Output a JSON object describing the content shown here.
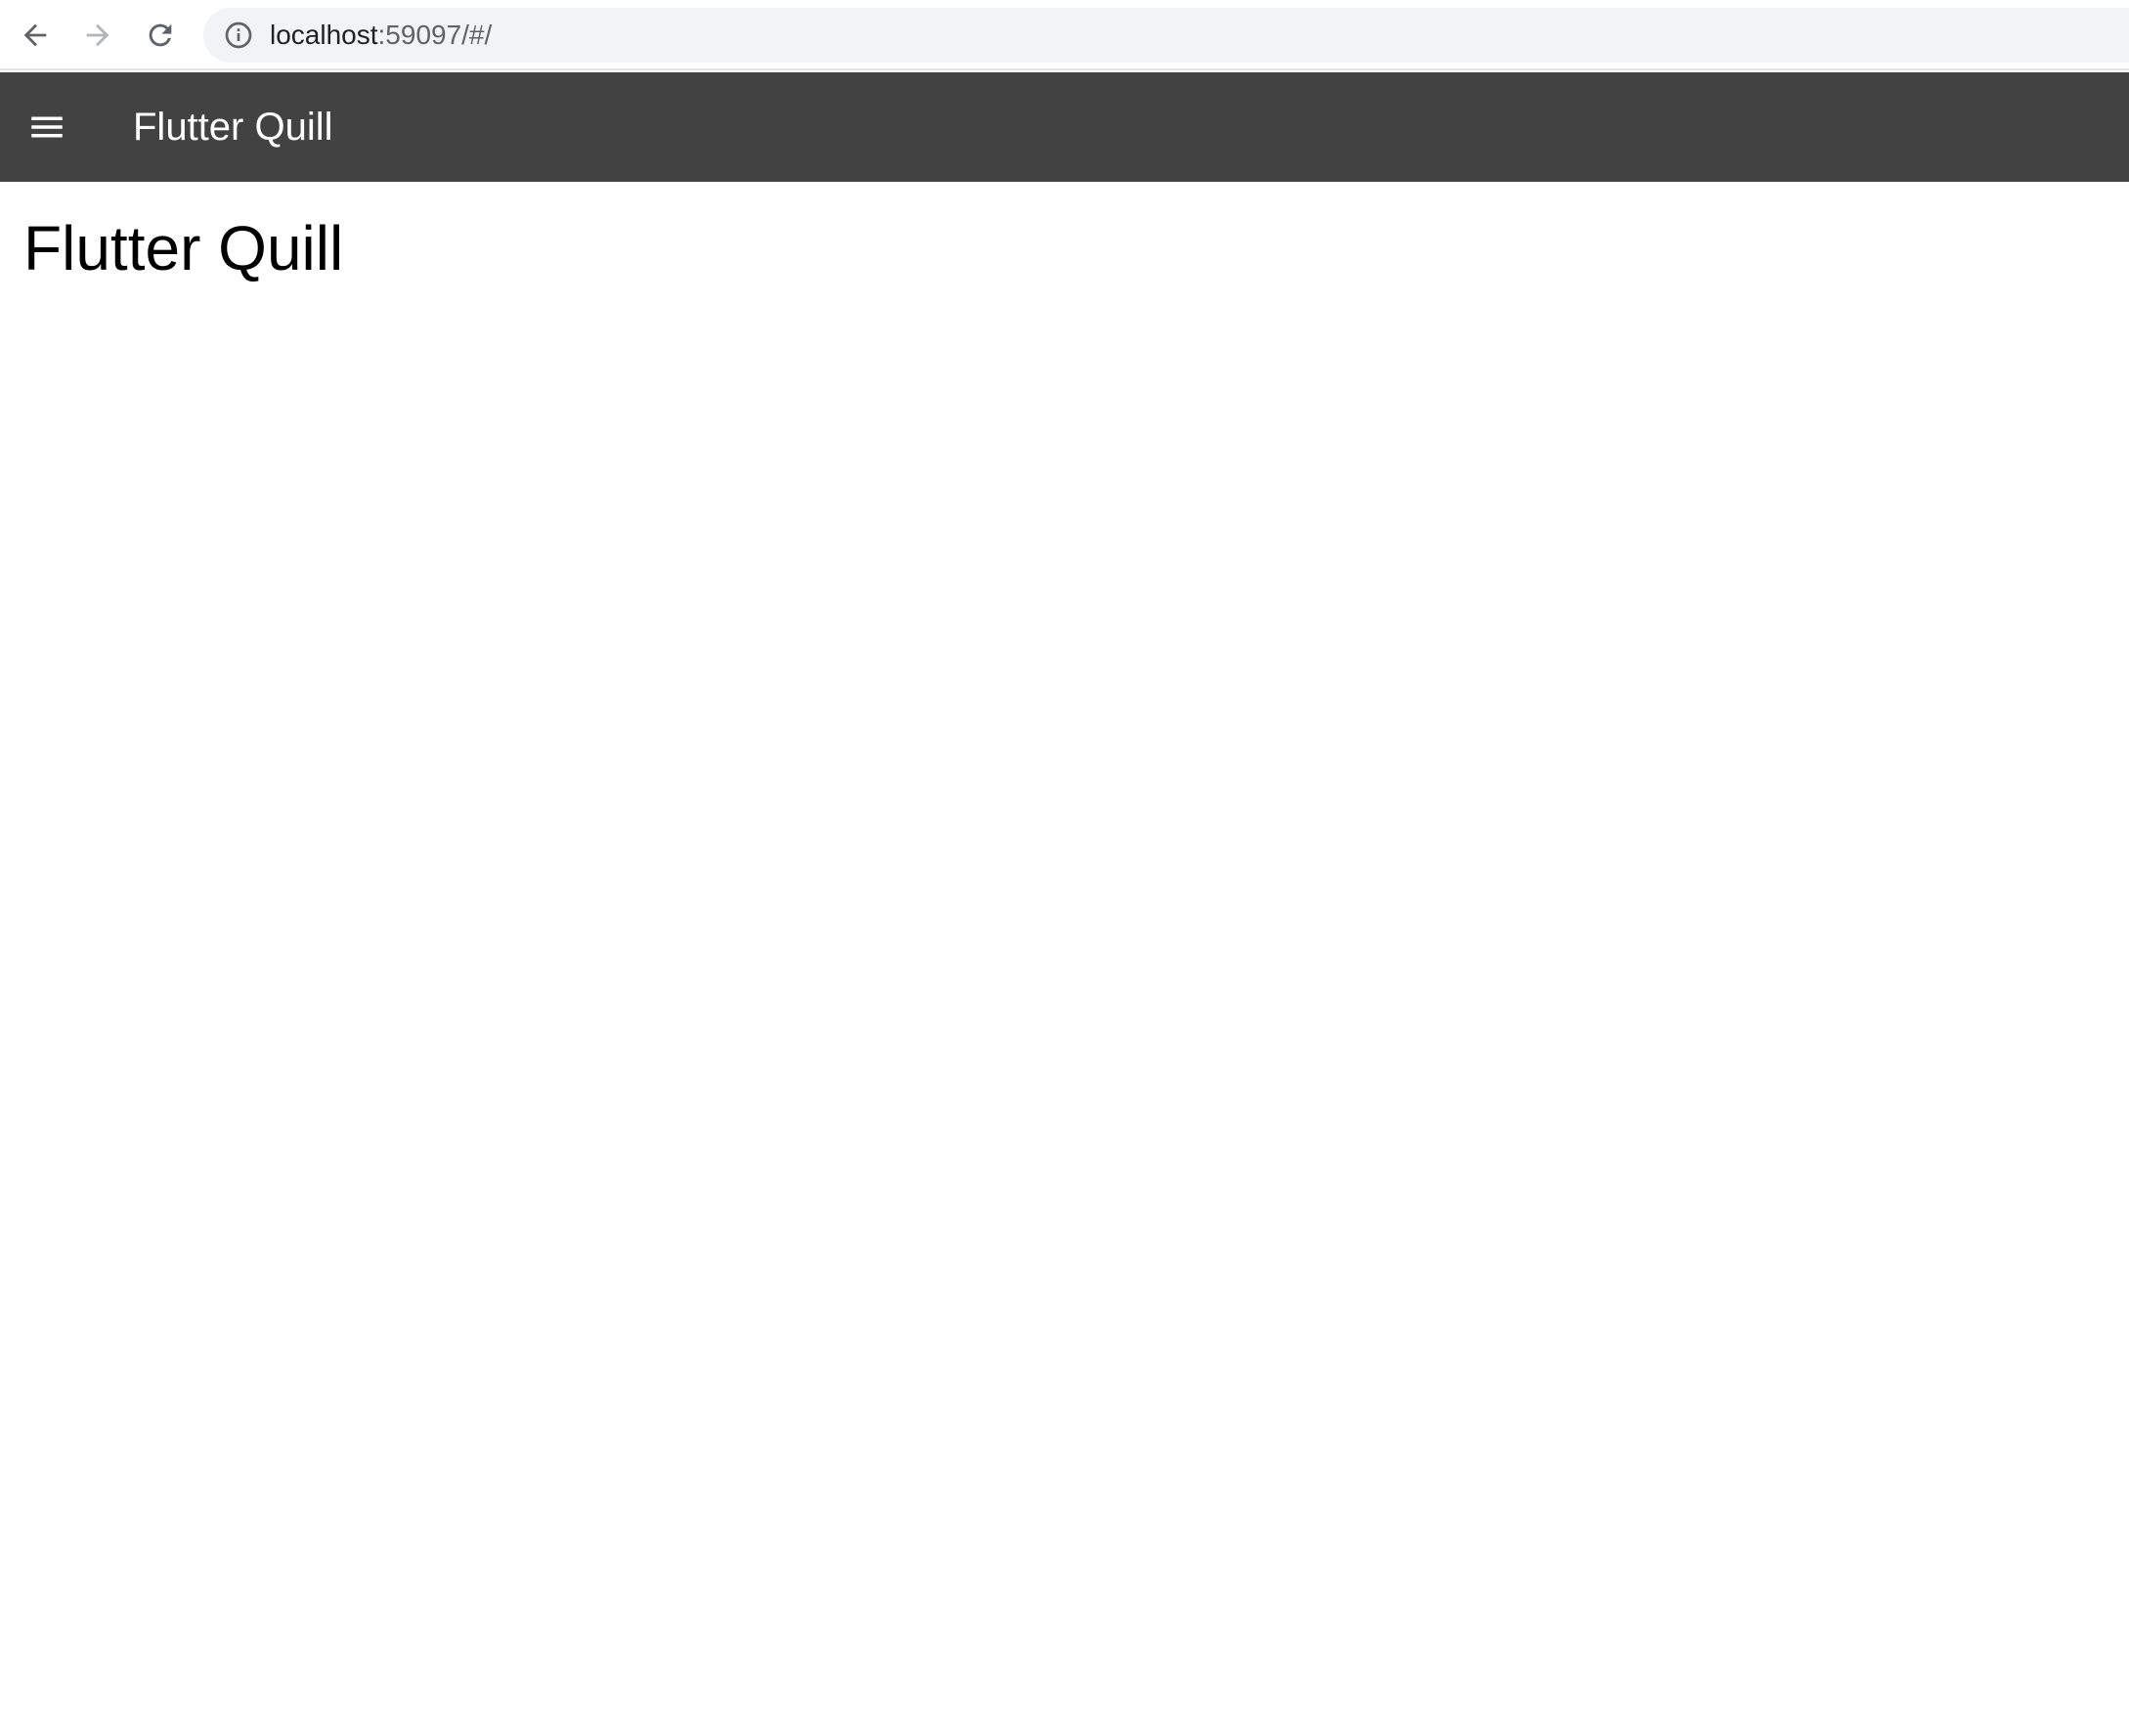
{
  "browser": {
    "url_host": "localhost",
    "url_rest": ":59097/#/",
    "icons": {
      "back": "arrow-left-icon",
      "forward": "arrow-right-icon",
      "reload": "reload-icon",
      "site_info": "info-circle-icon"
    }
  },
  "app_bar": {
    "title": "Flutter Quill",
    "background_color": "#424242",
    "menu_icon": "hamburger-menu-icon"
  },
  "main": {
    "heading": "Flutter Quill"
  }
}
